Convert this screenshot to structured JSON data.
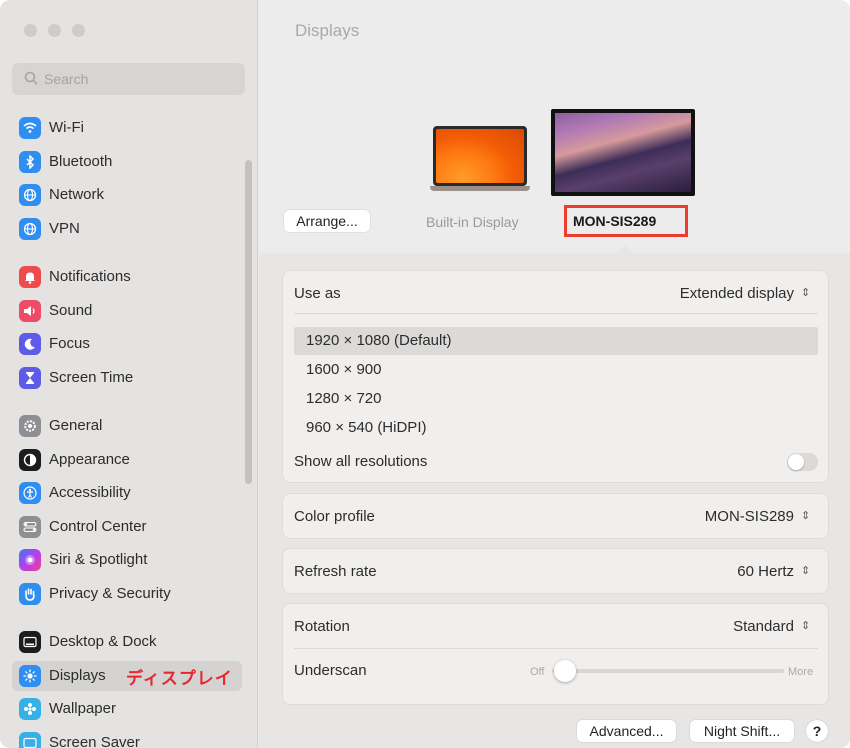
{
  "window": {
    "title": "Displays"
  },
  "search": {
    "placeholder": "Search"
  },
  "sidebar": {
    "items": [
      {
        "label": "Wi-Fi",
        "icon": "wifi-icon",
        "color": "#2f8ef0"
      },
      {
        "label": "Bluetooth",
        "icon": "bluetooth-icon",
        "color": "#2f8ef0"
      },
      {
        "label": "Network",
        "icon": "globe-icon",
        "color": "#2f8ef0"
      },
      {
        "label": "VPN",
        "icon": "globe-icon",
        "color": "#2f8ef0"
      },
      {
        "label": "Notifications",
        "icon": "bell-icon",
        "color": "#ef4b4b"
      },
      {
        "label": "Sound",
        "icon": "speaker-icon",
        "color": "#ef4b68"
      },
      {
        "label": "Focus",
        "icon": "moon-icon",
        "color": "#5e5ce6"
      },
      {
        "label": "Screen Time",
        "icon": "hourglass-icon",
        "color": "#5e5ce6"
      },
      {
        "label": "General",
        "icon": "gear-icon",
        "color": "#8e8e93"
      },
      {
        "label": "Appearance",
        "icon": "appearance-icon",
        "color": "#1c1c1e"
      },
      {
        "label": "Accessibility",
        "icon": "accessibility-icon",
        "color": "#2f8ef0"
      },
      {
        "label": "Control Center",
        "icon": "control-center-icon",
        "color": "#8e8e93"
      },
      {
        "label": "Siri & Spotlight",
        "icon": "siri-icon",
        "color": "#8e3ff0"
      },
      {
        "label": "Privacy & Security",
        "icon": "hand-icon",
        "color": "#2f8ef0"
      },
      {
        "label": "Desktop & Dock",
        "icon": "dock-icon",
        "color": "#1c1c1e"
      },
      {
        "label": "Displays",
        "icon": "sun-icon",
        "color": "#2f8ef0"
      },
      {
        "label": "Wallpaper",
        "icon": "wallpaper-icon",
        "color": "#36b0e6"
      },
      {
        "label": "Screen Saver",
        "icon": "screen-saver-icon",
        "color": "#36b0e6"
      }
    ],
    "annotation": "ディスプレイ"
  },
  "displays": {
    "arrange_label": "Arrange...",
    "builtin_label": "Built-in Display",
    "external_label": "MON-SIS289"
  },
  "settings": {
    "use_as_label": "Use as",
    "use_as_value": "Extended display",
    "resolutions": [
      "1920 × 1080 (Default)",
      "1600 × 900",
      "1280 × 720",
      "960 × 540 (HiDPI)"
    ],
    "show_all_label": "Show all resolutions",
    "color_profile_label": "Color profile",
    "color_profile_value": "MON-SIS289",
    "refresh_rate_label": "Refresh rate",
    "refresh_rate_value": "60 Hertz",
    "rotation_label": "Rotation",
    "rotation_value": "Standard",
    "underscan_label": "Underscan",
    "underscan_min": "Off",
    "underscan_max": "More",
    "underscan_value": 0
  },
  "footer": {
    "advanced_label": "Advanced...",
    "night_shift_label": "Night Shift...",
    "help_label": "?"
  }
}
